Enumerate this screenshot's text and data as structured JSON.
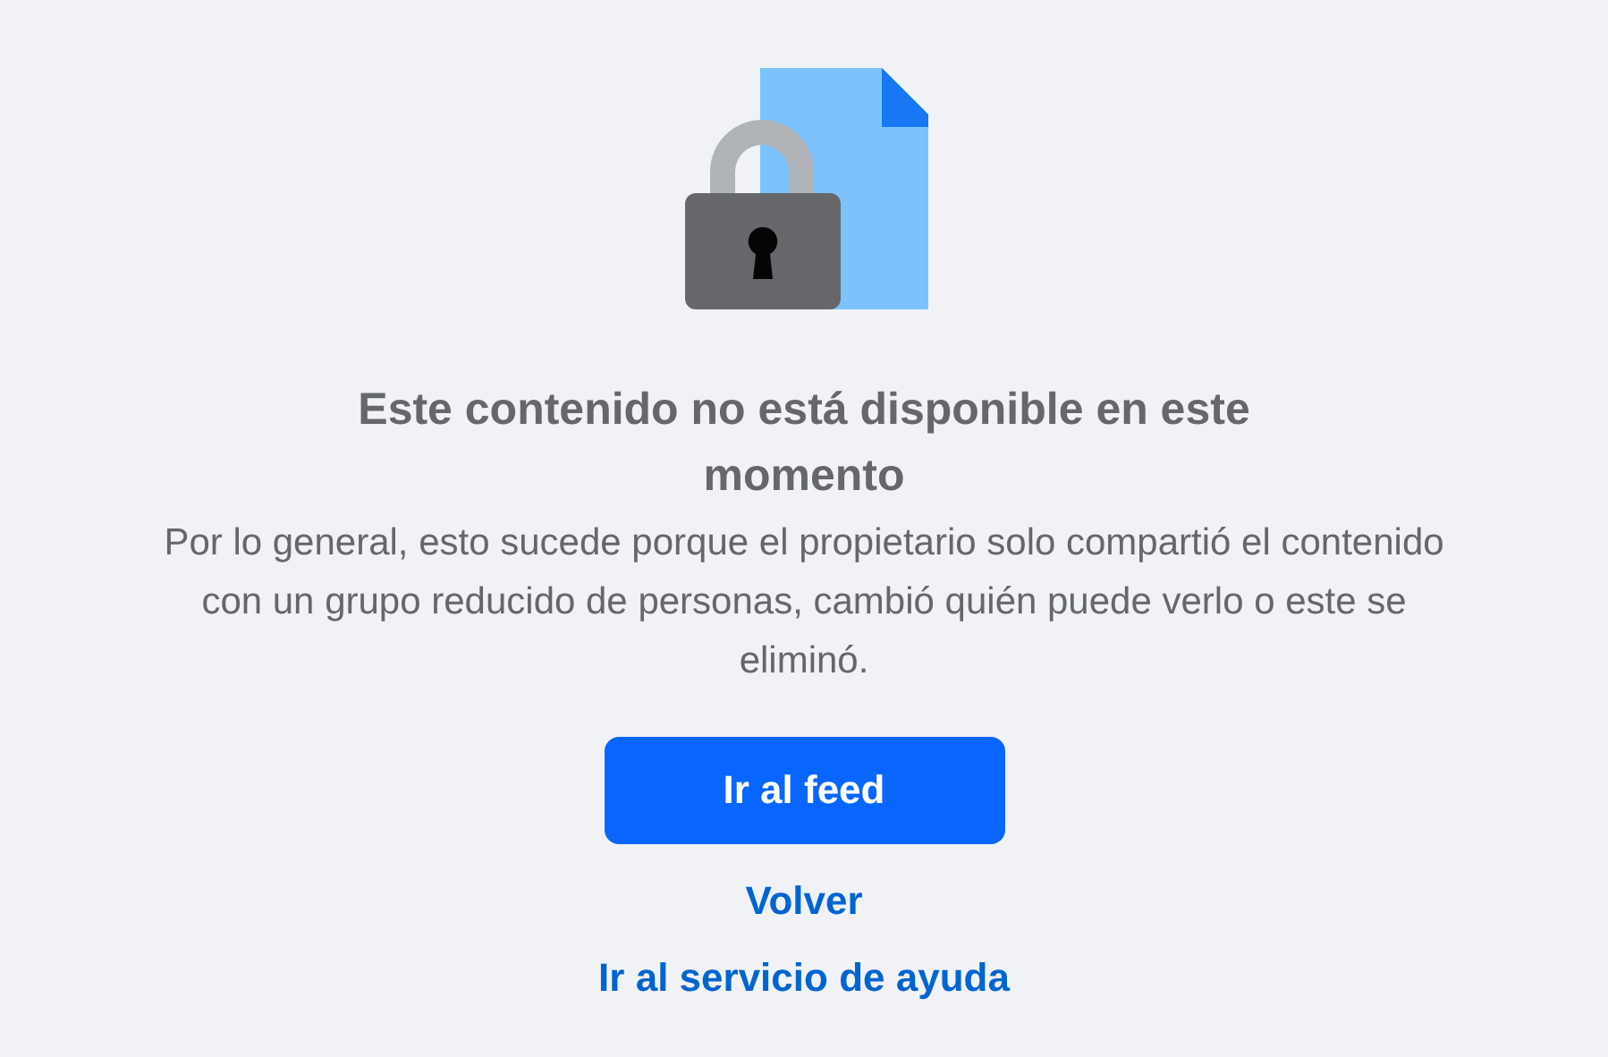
{
  "title": "Este contenido no está disponible en este momento",
  "message": "Por lo general, esto sucede porque el propietario solo compartió el contenido con un grupo reducido de personas, cambió quién puede verlo o este se eliminó.",
  "primary_button": "Ir al feed",
  "links": [
    "Volver",
    "Ir al servicio de ayuda"
  ]
}
